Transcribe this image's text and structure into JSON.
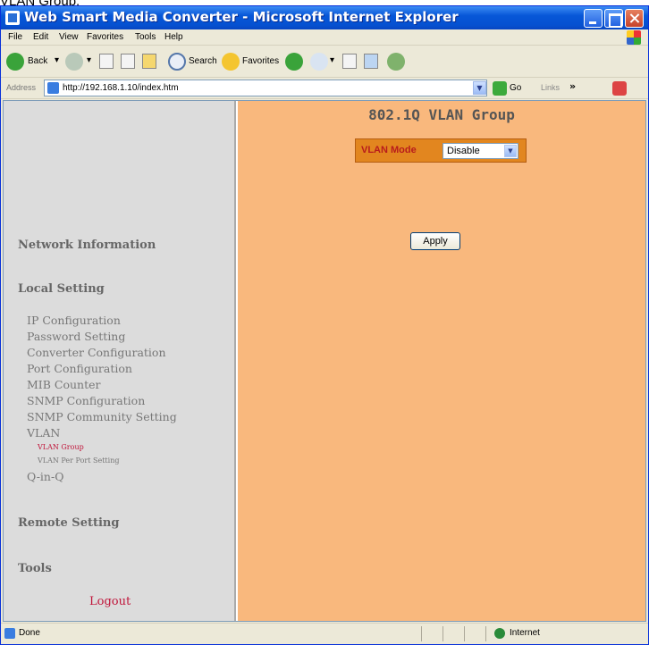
{
  "page_caption": "VLAN Group:",
  "window": {
    "title": "Web Smart Media Converter - Microsoft Internet Explorer"
  },
  "menu": [
    "File",
    "Edit",
    "View",
    "Favorites",
    "Tools",
    "Help"
  ],
  "toolbar": {
    "back": "Back",
    "search": "Search",
    "favorites": "Favorites"
  },
  "address": {
    "label": "Address",
    "url": "http://192.168.1.10/index.htm",
    "go": "Go",
    "links": "Links"
  },
  "sidebar": {
    "network_information": "Network Information",
    "local_setting": "Local Setting",
    "items": [
      "IP Configuration",
      "Password Setting",
      "Converter Configuration",
      "Port Configuration",
      "MIB Counter",
      "SNMP Configuration",
      "SNMP Community Setting",
      "VLAN"
    ],
    "vlan_sub": [
      "VLAN Group",
      "VLAN Per Port Setting"
    ],
    "qinq": "Q-in-Q",
    "remote_setting": "Remote Setting",
    "tools": "Tools",
    "logout": "Logout"
  },
  "main": {
    "title": "802.1Q VLAN Group",
    "vlan_mode_label": "VLAN Mode",
    "vlan_mode_value": "Disable",
    "apply": "Apply"
  },
  "status": {
    "left": "Done",
    "zone": "Internet"
  },
  "colors": {
    "main_bg": "#f9b87d",
    "sidebar_bg": "#dcdcdc",
    "active_link": "#c0163b",
    "vlan_row_bg": "#e2861f"
  }
}
